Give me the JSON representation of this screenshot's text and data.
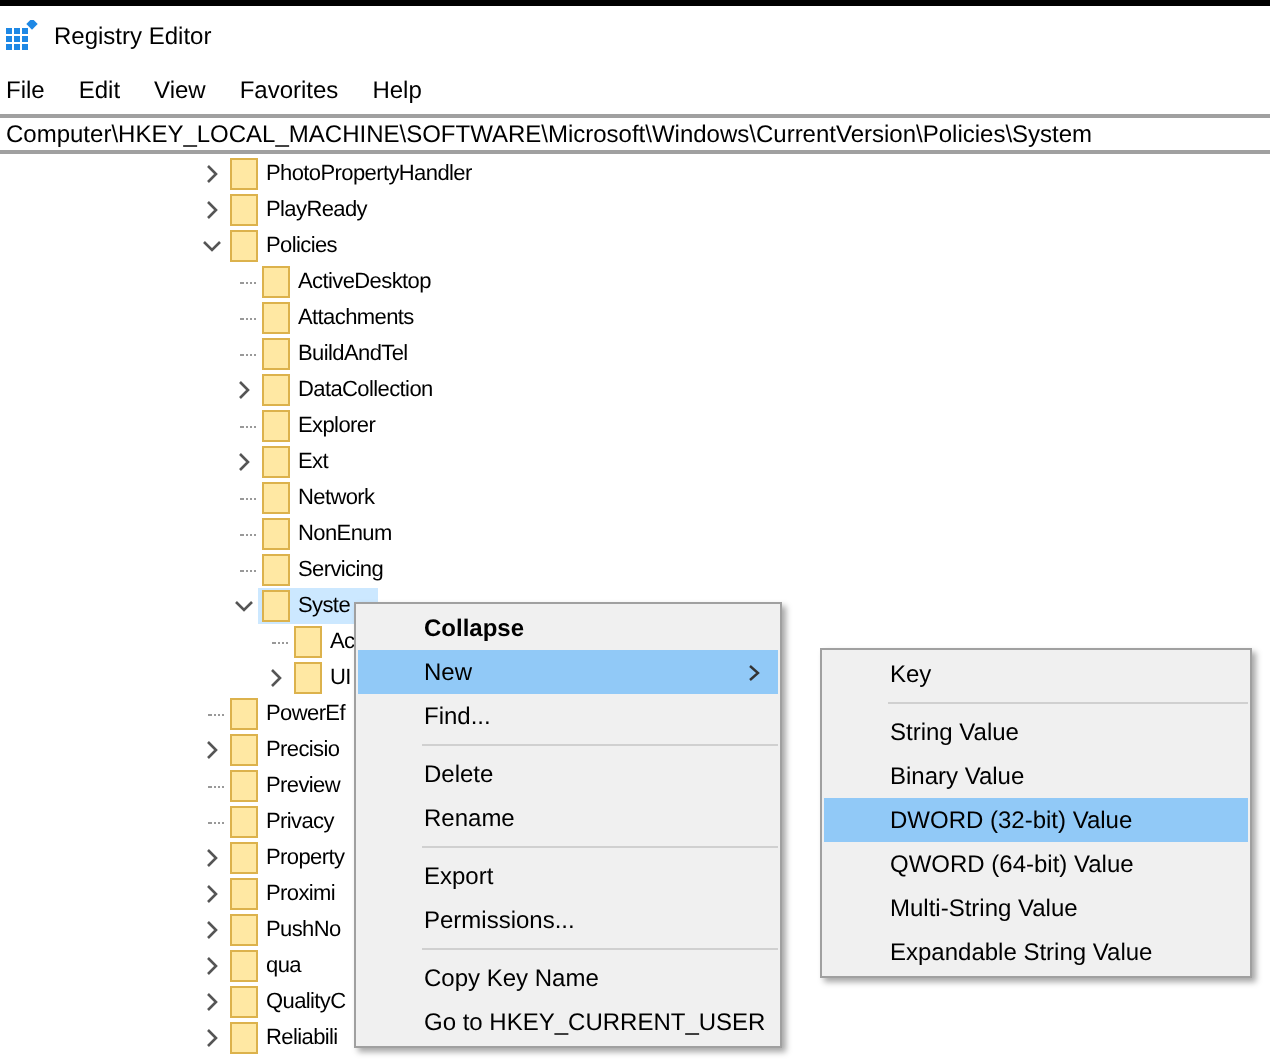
{
  "window": {
    "title": "Registry Editor"
  },
  "menu_bar": [
    "File",
    "Edit",
    "View",
    "Favorites",
    "Help"
  ],
  "address": "Computer\\HKEY_LOCAL_MACHINE\\SOFTWARE\\Microsoft\\Windows\\CurrentVersion\\Policies\\System",
  "tree": [
    {
      "name": "PhotoPropertyHandler",
      "has_children": true,
      "expanded": false,
      "selected": false
    },
    {
      "name": "PlayReady",
      "has_children": true,
      "expanded": false,
      "selected": false
    },
    {
      "name": "Policies",
      "has_children": true,
      "expanded": true,
      "selected": false,
      "children": [
        {
          "name": "ActiveDesktop",
          "has_children": false,
          "selected": false
        },
        {
          "name": "Attachments",
          "has_children": false,
          "selected": false
        },
        {
          "name": "BuildAndTel",
          "has_children": false,
          "selected": false
        },
        {
          "name": "DataCollection",
          "has_children": true,
          "expanded": false,
          "selected": false
        },
        {
          "name": "Explorer",
          "has_children": false,
          "selected": false
        },
        {
          "name": "Ext",
          "has_children": true,
          "expanded": false,
          "selected": false
        },
        {
          "name": "Network",
          "has_children": false,
          "selected": false
        },
        {
          "name": "NonEnum",
          "has_children": false,
          "selected": false
        },
        {
          "name": "Servicing",
          "has_children": false,
          "selected": false
        },
        {
          "name": "Syste",
          "has_children": true,
          "expanded": true,
          "selected": true,
          "children": [
            {
              "name": "Ac",
              "has_children": false,
              "selected": false
            },
            {
              "name": "UI",
              "has_children": true,
              "expanded": false,
              "selected": false
            }
          ]
        }
      ]
    },
    {
      "name": "PowerEf",
      "has_children": false,
      "selected": false
    },
    {
      "name": "Precisio",
      "has_children": true,
      "expanded": false,
      "selected": false
    },
    {
      "name": "Preview",
      "has_children": false,
      "selected": false
    },
    {
      "name": "Privacy",
      "has_children": false,
      "selected": false
    },
    {
      "name": "Property",
      "has_children": true,
      "expanded": false,
      "selected": false
    },
    {
      "name": "Proximi",
      "has_children": true,
      "expanded": false,
      "selected": false
    },
    {
      "name": "PushNo",
      "has_children": true,
      "expanded": false,
      "selected": false
    },
    {
      "name": "qua",
      "has_children": true,
      "expanded": false,
      "selected": false
    },
    {
      "name": "QualityC",
      "has_children": true,
      "expanded": false,
      "selected": false
    },
    {
      "name": "Reliabili",
      "has_children": true,
      "expanded": false,
      "selected": false
    }
  ],
  "context_menu": [
    {
      "kind": "item",
      "label": "Collapse",
      "bold": true,
      "selected": false,
      "submenu": false
    },
    {
      "kind": "item",
      "label": "New",
      "bold": false,
      "selected": true,
      "submenu": true
    },
    {
      "kind": "item",
      "label": "Find...",
      "bold": false,
      "selected": false,
      "submenu": false
    },
    {
      "kind": "separator"
    },
    {
      "kind": "item",
      "label": "Delete",
      "bold": false,
      "selected": false,
      "submenu": false
    },
    {
      "kind": "item",
      "label": "Rename",
      "bold": false,
      "selected": false,
      "submenu": false
    },
    {
      "kind": "separator"
    },
    {
      "kind": "item",
      "label": "Export",
      "bold": false,
      "selected": false,
      "submenu": false
    },
    {
      "kind": "item",
      "label": "Permissions...",
      "bold": false,
      "selected": false,
      "submenu": false
    },
    {
      "kind": "separator"
    },
    {
      "kind": "item",
      "label": "Copy Key Name",
      "bold": false,
      "selected": false,
      "submenu": false
    },
    {
      "kind": "item",
      "label": "Go to HKEY_CURRENT_USER",
      "bold": false,
      "selected": false,
      "submenu": false
    }
  ],
  "submenu": [
    {
      "kind": "item",
      "label": "Key",
      "selected": false
    },
    {
      "kind": "separator"
    },
    {
      "kind": "item",
      "label": "String Value",
      "selected": false
    },
    {
      "kind": "item",
      "label": "Binary Value",
      "selected": false
    },
    {
      "kind": "item",
      "label": "DWORD (32-bit) Value",
      "selected": true
    },
    {
      "kind": "item",
      "label": "QWORD (64-bit) Value",
      "selected": false
    },
    {
      "kind": "item",
      "label": "Multi-String Value",
      "selected": false
    },
    {
      "kind": "item",
      "label": "Expandable String Value",
      "selected": false
    }
  ]
}
